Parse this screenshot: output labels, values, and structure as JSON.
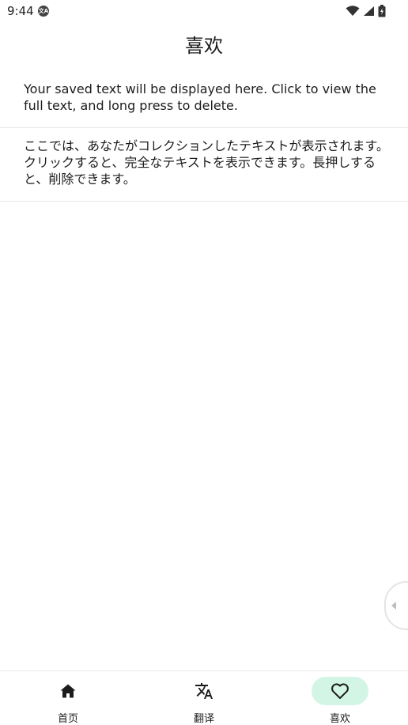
{
  "status_bar": {
    "time": "9:44",
    "notification_icon": "translate-badge-icon",
    "icons": [
      "wifi-icon",
      "cell-signal-icon",
      "battery-icon"
    ]
  },
  "header": {
    "title": "喜欢"
  },
  "saved_items": [
    {
      "text": "Your saved text will be displayed here. Click to view the full text, and long press to delete."
    },
    {
      "text": "ここでは、あなたがコレクションしたテキストが表示されます。クリックすると、完全なテキストを表示できます。長押しすると、削除できます。"
    }
  ],
  "bottom_nav": {
    "items": [
      {
        "label": "首页",
        "icon": "home-icon",
        "active": false
      },
      {
        "label": "翻译",
        "icon": "translate-icon",
        "active": false
      },
      {
        "label": "喜欢",
        "icon": "heart-icon",
        "active": true
      }
    ]
  },
  "colors": {
    "active_tab_bg": "#d3f5e6",
    "divider": "#e6e6e6",
    "text": "#1c1c1c"
  }
}
